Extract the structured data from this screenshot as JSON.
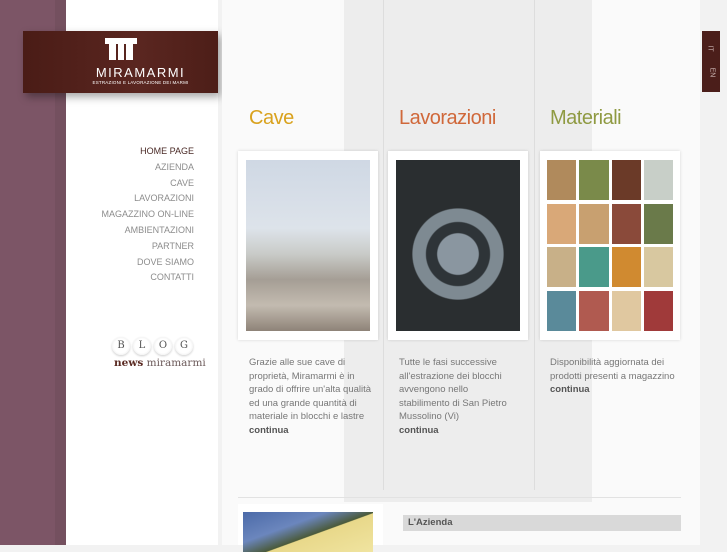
{
  "logo": {
    "name": "MIRAMARMI",
    "tagline": "ESTRAZIONI E LAVORAZIONE DEI MARMI"
  },
  "language": {
    "items": [
      "IT",
      "EN"
    ]
  },
  "nav": {
    "items": [
      "HOME PAGE",
      "AZIENDA",
      "CAVE",
      "LAVORAZIONI",
      "MAGAZZINO ON-LINE",
      "AMBIENTAZIONI",
      "PARTNER",
      "DOVE SIAMO",
      "CONTATTI"
    ],
    "active": "HOME PAGE"
  },
  "blog": {
    "letters": [
      "B",
      "L",
      "O",
      "G"
    ],
    "news": "news",
    "brand": "miramarmi"
  },
  "sections": [
    {
      "title": "Cave",
      "color": "#d9a21e",
      "text": "Grazie alle sue cave di proprietà, Miramarmi è in grado di offrire un'alta qualità ed una grande quantità di materiale in blocchi e lastre",
      "link": "continua"
    },
    {
      "title": "Lavorazioni",
      "color": "#d0683a",
      "text": "Tutte le fasi successive all'estrazione dei blocchi avvengono nello stabilimento di San Pietro Mussolino (Vi)",
      "link": "continua"
    },
    {
      "title": "Materiali",
      "color": "#8f9a42",
      "text": "Disponibilità aggiornata dei prodotti presenti a magazzino",
      "link": "continua"
    }
  ],
  "materials_swatches": [
    "#b08a5c",
    "#7a8a4a",
    "#6b3a28",
    "#c8cfc8",
    "#d9a878",
    "#c8a070",
    "#8a4a3a",
    "#6a7a4a",
    "#c8b088",
    "#4a9a8a",
    "#d08a30",
    "#d8c8a0",
    "#5a8a9a",
    "#b05a50",
    "#e0c8a0",
    "#a03a3a"
  ],
  "azienda": {
    "heading": "L'Azienda"
  }
}
